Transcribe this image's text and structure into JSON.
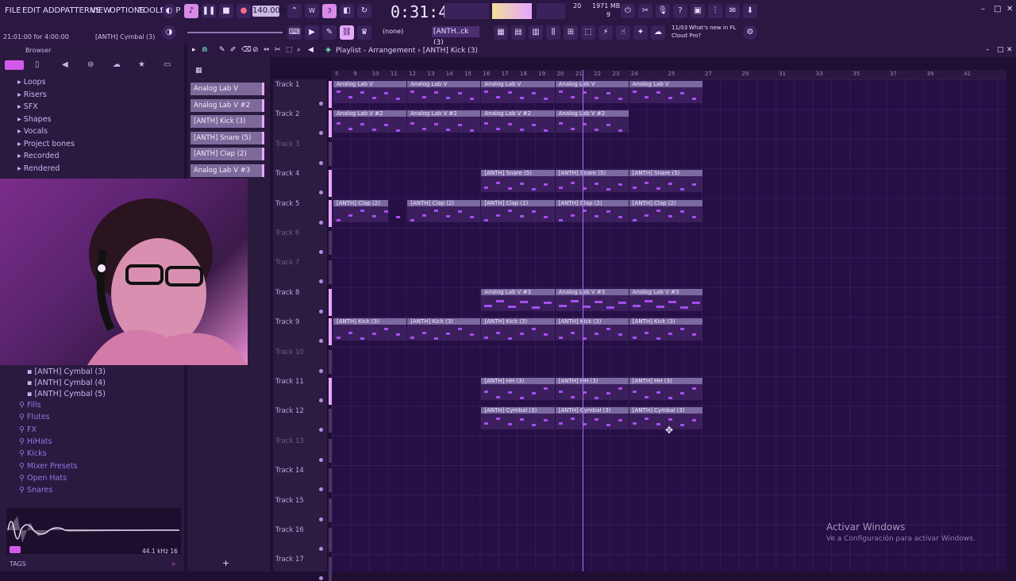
{
  "menu": [
    "FILE",
    "EDIT",
    "ADD",
    "PATTERNS",
    "VIEW",
    "OPTIONS",
    "TOOLS",
    "HELP"
  ],
  "transport": {
    "bpm": "140.000",
    "time": "0:31:45",
    "time_label": "M:S:CS",
    "cpu": "20",
    "mem": "1971 MB",
    "voices": "9"
  },
  "status_hint": "21:01:00 for 4:00:00",
  "status_hint2": "[ANTH] Cymbal (3)",
  "snap": "(none)",
  "pattern": "[ANTH..ck (3)",
  "news": {
    "date": "11/03",
    "text1": "What's new in FL",
    "text2": "Cloud Pro?"
  },
  "browser": {
    "title": "Browser",
    "items_top": [
      "Loops",
      "Risers",
      "SFX",
      "Shapes",
      "Vocals",
      "Project bones",
      "Recorded",
      "Rendered"
    ],
    "items_mid": [
      "[ANTH] Cymbal (3)",
      "[ANTH] Cymbal (4)",
      "[ANTH] Cymbal (5)"
    ],
    "items_bottom": [
      "Fills",
      "Flutes",
      "FX",
      "HiHats",
      "Kicks",
      "Mixer Presets",
      "Open Hats",
      "Snares"
    ],
    "freq": "44.1 kHz 16",
    "tags": "TAGS"
  },
  "playlist": {
    "title": "Playlist - Arrangement",
    "pattern": "[ANTH] Kick (3)"
  },
  "channels": [
    "Analog Lab V",
    "Analog Lab V #2",
    "[ANTH] Kick (3)",
    "[ANTH] Snare (5)",
    "[ANTH] Clap (2)",
    "Analog Lab V #3"
  ],
  "tracks": [
    "Track 1",
    "Track 2",
    "Track 3",
    "Track 4",
    "Track 5",
    "Track 6",
    "Track 7",
    "Track 8",
    "Track 9",
    "Track 10",
    "Track 11",
    "Track 12",
    "Track 13",
    "Track 14",
    "Track 15",
    "Track 16",
    "Track 17"
  ],
  "ruler": [
    "5",
    "9",
    "10",
    "11",
    "12",
    "13",
    "14",
    "15",
    "16",
    "17",
    "18",
    "19",
    "20",
    "21",
    "22",
    "23",
    "24",
    "25",
    "27",
    "29",
    "31",
    "33",
    "35",
    "37",
    "39",
    "41"
  ],
  "clips": [
    {
      "track": 0,
      "label": "Analog Lab V",
      "start": 0,
      "len": 4
    },
    {
      "track": 0,
      "label": "Analog Lab V",
      "start": 4,
      "len": 4
    },
    {
      "track": 0,
      "label": "Analog Lab V",
      "start": 8,
      "len": 4
    },
    {
      "track": 0,
      "label": "Analog Lab V",
      "start": 12,
      "len": 4
    },
    {
      "track": 0,
      "label": "Analog Lab V",
      "start": 16,
      "len": 4
    },
    {
      "track": 1,
      "label": "Analog Lab V #2",
      "start": 0,
      "len": 4
    },
    {
      "track": 1,
      "label": "Analog Lab V #2",
      "start": 4,
      "len": 4
    },
    {
      "track": 1,
      "label": "Analog Lab V #2",
      "start": 8,
      "len": 4
    },
    {
      "track": 1,
      "label": "Analog Lab V #2",
      "start": 12,
      "len": 4
    },
    {
      "track": 3,
      "label": "[ANTH] Snare (5)",
      "start": 8,
      "len": 4
    },
    {
      "track": 3,
      "label": "[ANTH] Snare (5)",
      "start": 12,
      "len": 4
    },
    {
      "track": 3,
      "label": "[ANTH] Snare (5)",
      "start": 16,
      "len": 4
    },
    {
      "track": 4,
      "label": "[ANTH] Clap (2)",
      "start": 0,
      "len": 3
    },
    {
      "track": 4,
      "label": "[ANTH] Clap (2)",
      "start": 4,
      "len": 4
    },
    {
      "track": 4,
      "label": "[ANTH] Clap (2)",
      "start": 8,
      "len": 4
    },
    {
      "track": 4,
      "label": "[ANTH] Clap (2)",
      "start": 12,
      "len": 4
    },
    {
      "track": 4,
      "label": "[ANTH] Clap (2)",
      "start": 16,
      "len": 4
    },
    {
      "track": 7,
      "label": "Analog Lab V #3",
      "start": 8,
      "len": 4
    },
    {
      "track": 7,
      "label": "Analog Lab V #3",
      "start": 12,
      "len": 4
    },
    {
      "track": 7,
      "label": "Analog Lab V #3",
      "start": 16,
      "len": 4
    },
    {
      "track": 8,
      "label": "[ANTH] Kick (3)",
      "start": 0,
      "len": 4
    },
    {
      "track": 8,
      "label": "[ANTH] Kick (3)",
      "start": 4,
      "len": 4
    },
    {
      "track": 8,
      "label": "[ANTH] Kick (3)",
      "start": 8,
      "len": 4
    },
    {
      "track": 8,
      "label": "[ANTH] Kick (3)",
      "start": 12,
      "len": 4
    },
    {
      "track": 8,
      "label": "[ANTH] Kick (3)",
      "start": 16,
      "len": 4
    },
    {
      "track": 10,
      "label": "[ANTH] HH (3)",
      "start": 8,
      "len": 4
    },
    {
      "track": 10,
      "label": "[ANTH] HH (3)",
      "start": 12,
      "len": 4
    },
    {
      "track": 10,
      "label": "[ANTH] HH (3)",
      "start": 16,
      "len": 4
    },
    {
      "track": 11,
      "label": "[ANTH] Cymbal (3)",
      "start": 8,
      "len": 4
    },
    {
      "track": 11,
      "label": "[ANTH] Cymbal (3)",
      "start": 12,
      "len": 4
    },
    {
      "track": 11,
      "label": "[ANTH] Cymbal (3)",
      "start": 16,
      "len": 4
    }
  ],
  "watermark": {
    "line1": "Activar Windows",
    "line2": "Ve a Configuración para activar Windows."
  },
  "colors": {
    "accent": "#b36cff",
    "clip_label": "#7b6aa0",
    "note": "#a64df0",
    "background": "#250f45"
  }
}
